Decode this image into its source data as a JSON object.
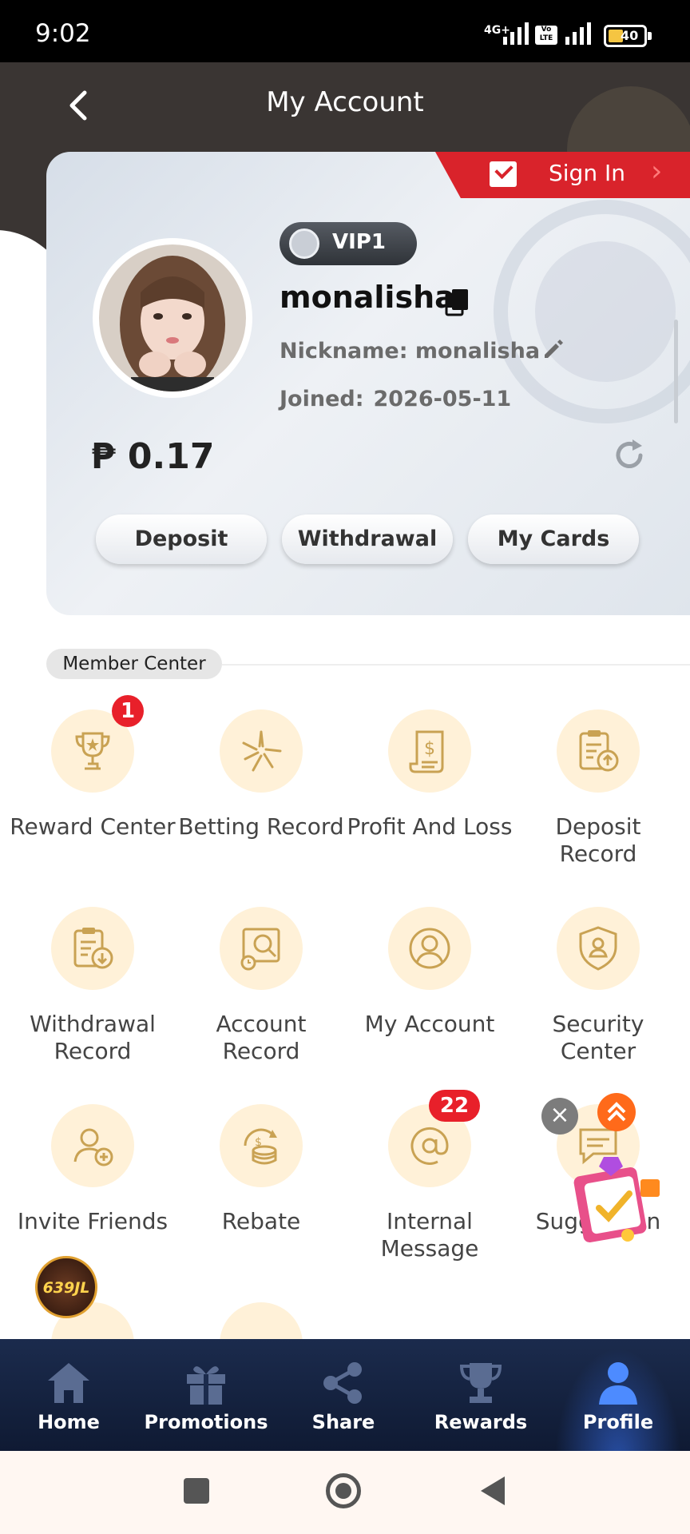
{
  "status_bar": {
    "time": "9:02",
    "network": "4G+",
    "volte": "Vo LTE",
    "battery": "40"
  },
  "header": {
    "title": "My Account"
  },
  "card": {
    "sign_in_label": "Sign In",
    "vip_level": "VIP1",
    "username": "monalisha",
    "nickname": "Nickname: monalisha",
    "joined_label": "Joined:",
    "joined_date": "2026-05-11",
    "balance": "₱ 0.17",
    "buttons": {
      "deposit": "Deposit",
      "withdrawal": "Withdrawal",
      "my_cards": "My Cards"
    }
  },
  "member_center": {
    "title": "Member Center",
    "items": [
      {
        "label": "Reward Center",
        "icon": "trophy-icon",
        "badge": "1"
      },
      {
        "label": "Betting Record",
        "icon": "sparkle-icon"
      },
      {
        "label": "Profit And Loss",
        "icon": "receipt-dollar-icon"
      },
      {
        "label": "Deposit Record",
        "icon": "clipboard-upload-icon"
      },
      {
        "label": "Withdrawal Record",
        "icon": "clipboard-download-icon"
      },
      {
        "label": "Account Record",
        "icon": "account-record-icon"
      },
      {
        "label": "My Account",
        "icon": "user-circle-icon"
      },
      {
        "label": "Security Center",
        "icon": "shield-user-icon"
      },
      {
        "label": "Invite Friends",
        "icon": "user-plus-icon"
      },
      {
        "label": "Rebate",
        "icon": "coins-icon"
      },
      {
        "label": "Internal Message",
        "icon": "at-sign-icon",
        "badge": "22"
      },
      {
        "label": "Suggestion",
        "icon": "chat-icon"
      }
    ]
  },
  "floating": {
    "logo": "639JL"
  },
  "bottom_nav": [
    {
      "label": "Home",
      "icon": "home-icon"
    },
    {
      "label": "Promotions",
      "icon": "gift-icon"
    },
    {
      "label": "Share",
      "icon": "share-icon"
    },
    {
      "label": "Rewards",
      "icon": "trophy-icon"
    },
    {
      "label": "Profile",
      "icon": "person-icon",
      "active": true
    }
  ],
  "colors": {
    "accent": "#d9232b",
    "icon_gold": "#c9a253",
    "icon_bg": "#fff1d8",
    "nav_bg": "#1b2b4d"
  }
}
